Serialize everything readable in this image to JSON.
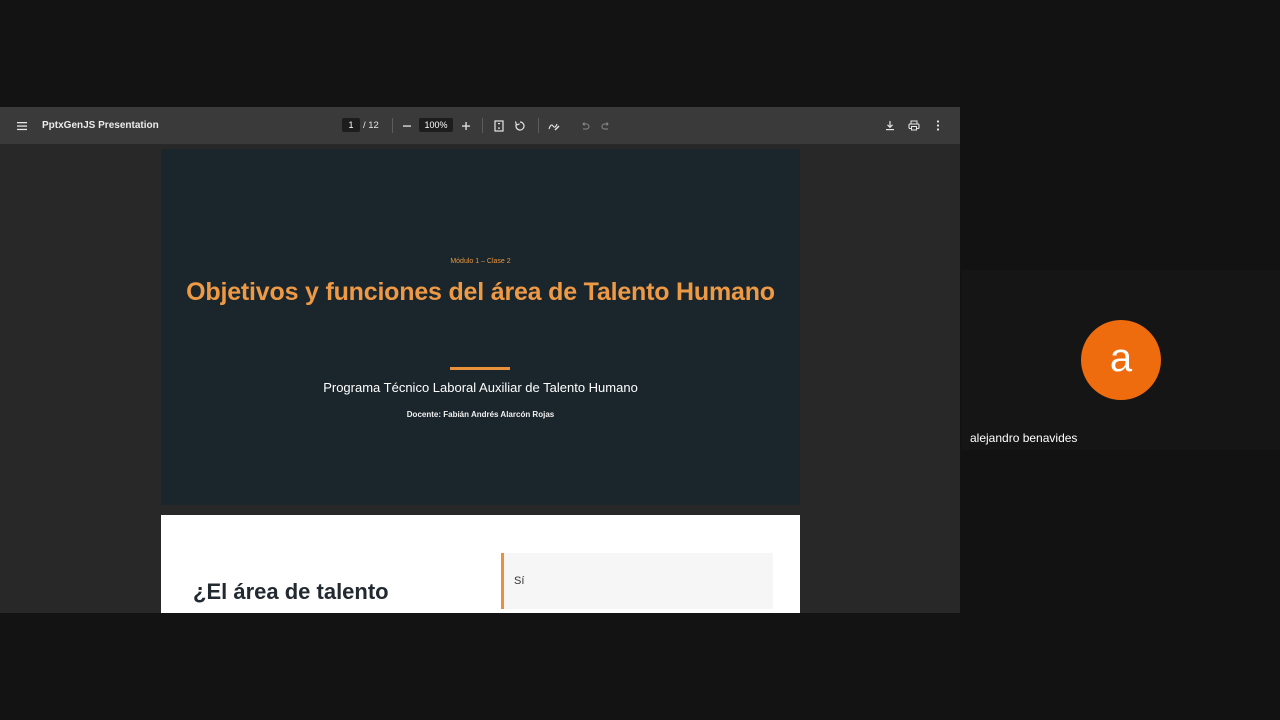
{
  "viewer": {
    "document_title": "PptxGenJS Presentation",
    "current_page": "1",
    "page_total": "/ 12",
    "zoom": "100%",
    "icons": [
      "menu-icon",
      "zoom-out-icon",
      "zoom-in-icon",
      "fit-page-icon",
      "rotate-icon",
      "annotate-icon",
      "undo-icon",
      "redo-icon",
      "download-icon",
      "print-icon",
      "more-options-icon"
    ]
  },
  "slides": [
    {
      "module": "Módulo 1 – Clase 2",
      "title": "Objetivos y funciones del área de Talento Humano",
      "program": "Programa Técnico Laboral Auxiliar de Talento Humano",
      "teacher": "Docente: Fabián Andrés Alarcón Rojas"
    },
    {
      "question": "¿El área de talento",
      "answer": "Sí"
    }
  ],
  "participant": {
    "avatar_letter": "a",
    "name": "alejandro benavides",
    "avatar_color": "#EE6C0E"
  },
  "colors": {
    "accent_orange": "#E8913A",
    "slide_dark_bg": "#1B262C",
    "toolbar_bg": "#3A3A3A"
  }
}
